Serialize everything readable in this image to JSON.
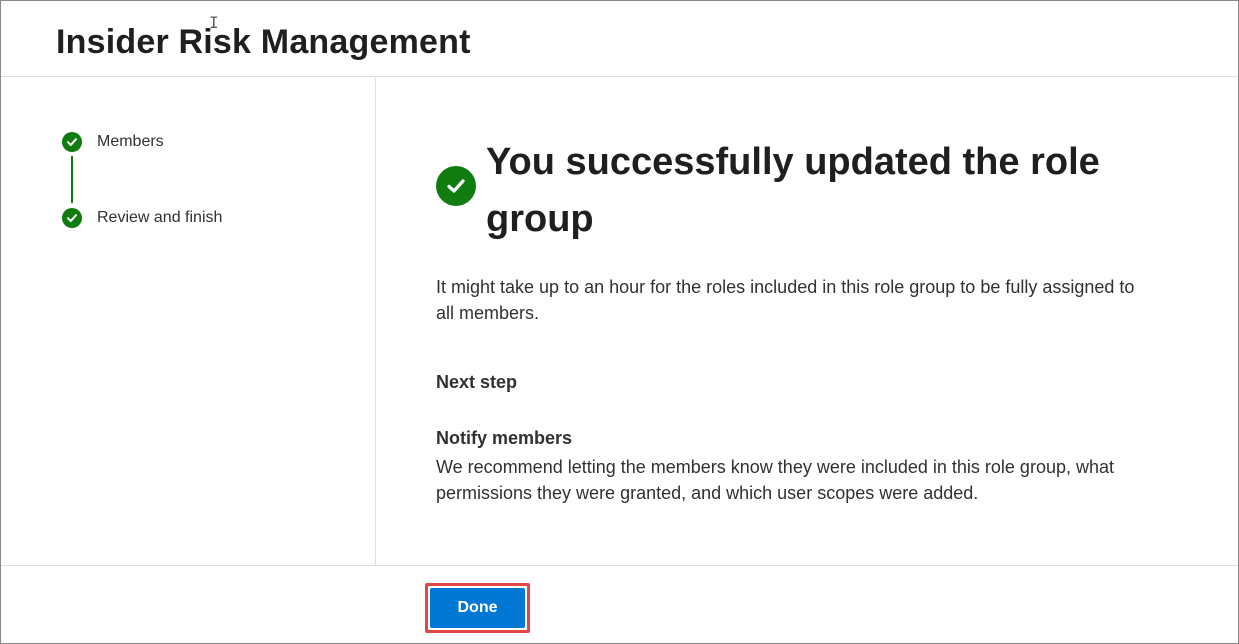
{
  "header": {
    "title": "Insider Risk Management"
  },
  "steps": [
    {
      "label": "Members",
      "status": "completed"
    },
    {
      "label": "Review and finish",
      "status": "completed"
    }
  ],
  "main": {
    "success_title": "You successfully updated the role group",
    "info_text": "It might take up to an hour for the roles included in this role group to be fully assigned to all members.",
    "next_step_heading": "Next step",
    "notify_heading": "Notify members",
    "notify_text": "We recommend letting the members know they were included in this role group, what permissions they were granted, and which user scopes were added."
  },
  "footer": {
    "done_label": "Done"
  },
  "colors": {
    "success_green": "#107c10",
    "primary_blue": "#0078d4",
    "highlight_red": "#e0474c"
  }
}
